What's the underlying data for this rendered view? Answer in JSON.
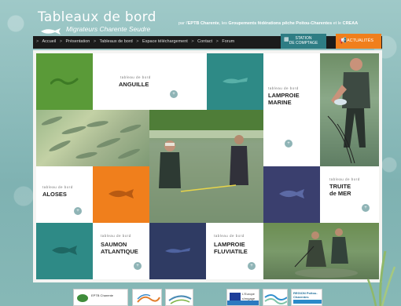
{
  "header": {
    "title": "Tableaux de bord",
    "subtitle": "Migrateurs Charente Seudre",
    "partners_prefix": "par l'",
    "partner1": "EPTB Charente",
    "partners_mid": ", les",
    "partner2": "Groupements fédérations pêche Poitou-Charentes",
    "partners_and": "et le",
    "partner3": "CREAA"
  },
  "nav": {
    "items": [
      "Accueil",
      "Présentation",
      "Tableaux de bord",
      "Espace téléchargement",
      "Contact",
      "Forum"
    ],
    "separator": ">"
  },
  "buttons": {
    "station_line1": "STATION",
    "station_line2": "DE COMPTAGE",
    "actualites": "ACTUALITÉS"
  },
  "tiles": {
    "label": "tableau de bord",
    "anguille": "ANGUILLE",
    "lamproie_marine_1": "LAMPROIE",
    "lamproie_marine_2": "MARINE",
    "aloses": "ALOSES",
    "truite_1": "TRUITE",
    "truite_2": "de MER",
    "saumon_1": "SAUMON",
    "saumon_2": "ATLANTIQUE",
    "lamproie_fluv_1": "LAMPROIE",
    "lamproie_fluv_2": "FLUVIATILE",
    "more_glyph": "+"
  },
  "footer": {
    "logo1": "EPTB Charente",
    "logo4a": "L'Europe",
    "logo4b": "s'engage",
    "logo5": "REGION Poitou-Charentes"
  },
  "colors": {
    "green": "#5a9a38",
    "teal": "#2e8a86",
    "orange": "#f07f1c",
    "navy": "#3a3f6e",
    "deepblue": "#2f3b63"
  }
}
